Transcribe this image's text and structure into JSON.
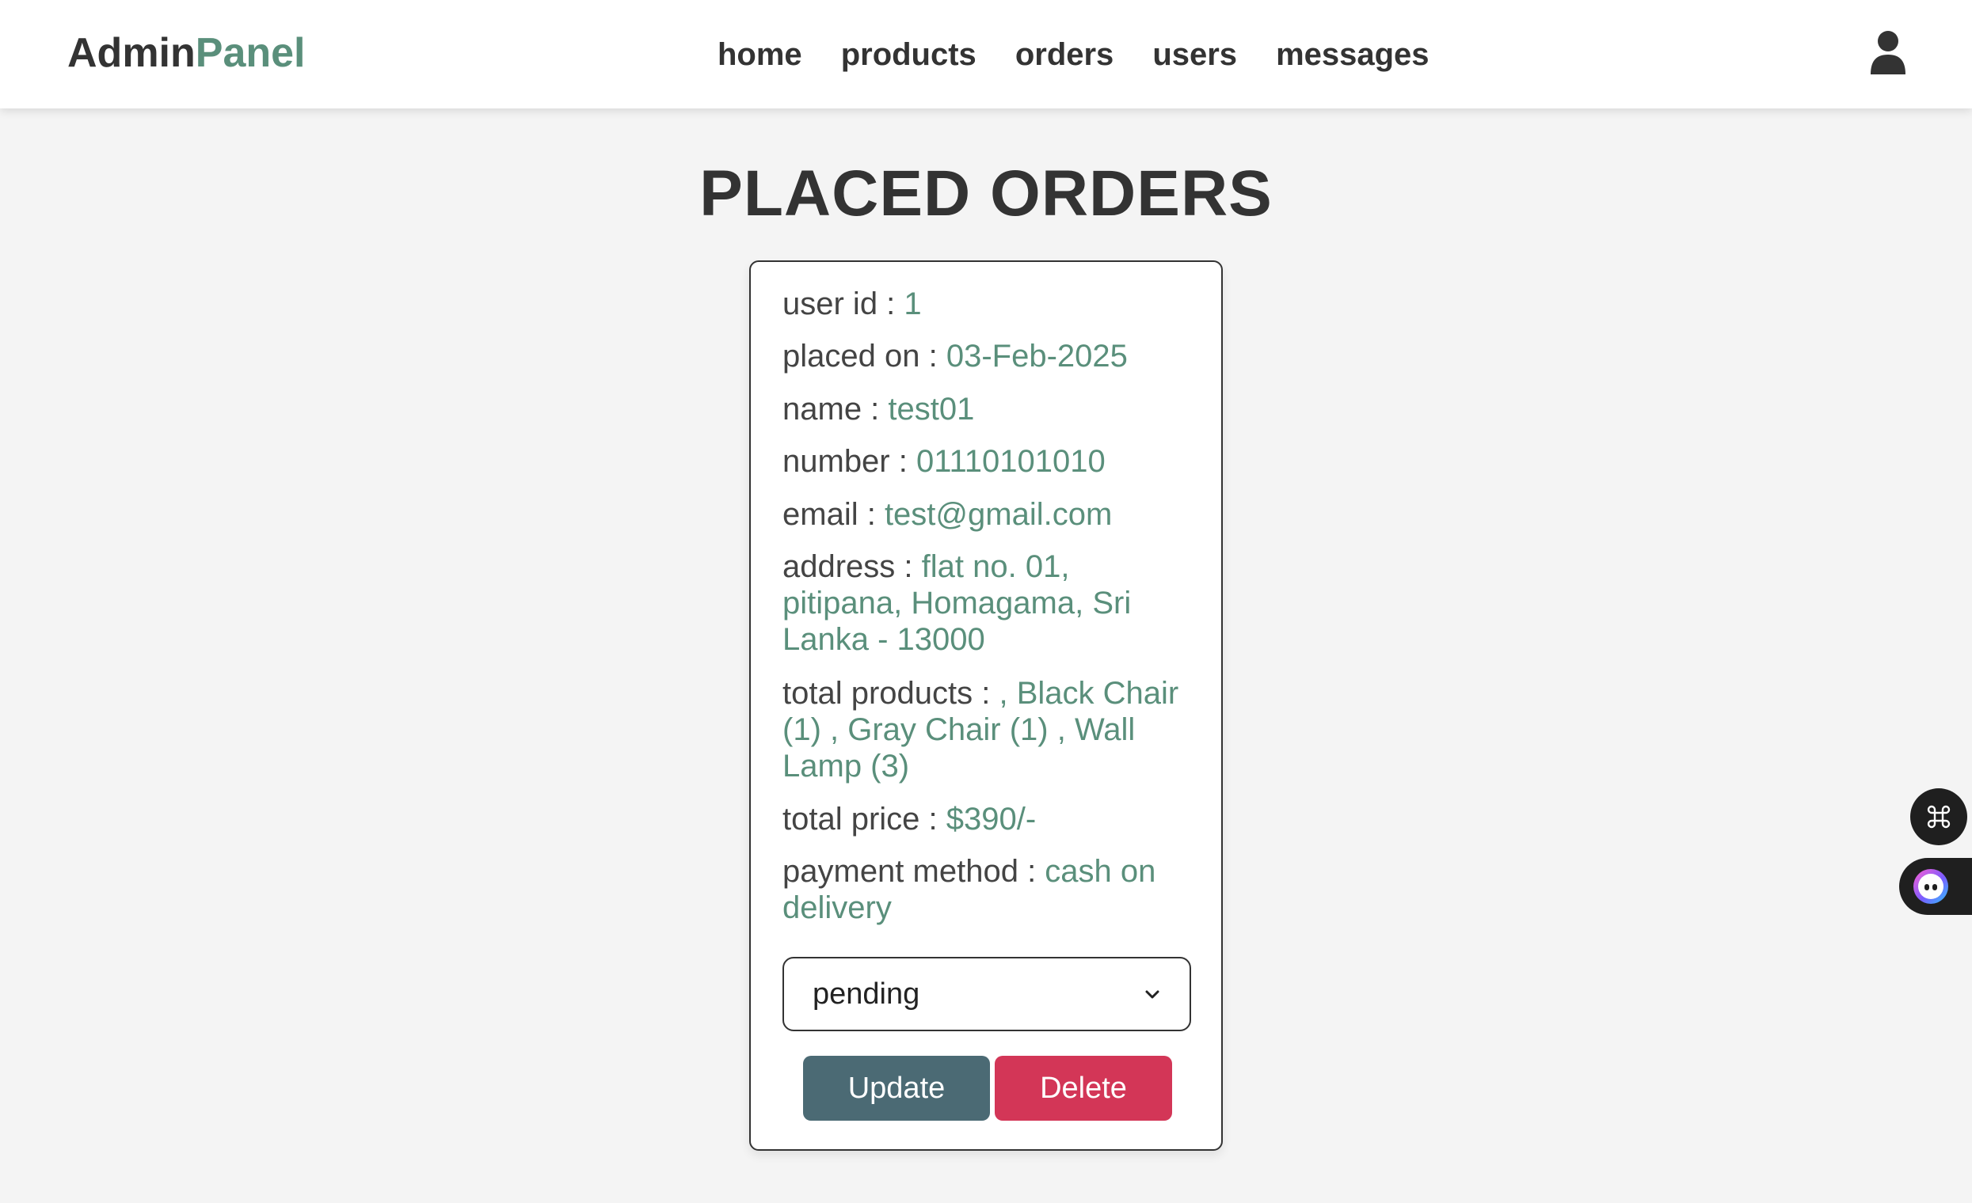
{
  "header": {
    "logo_part1": "Admin",
    "logo_part2": "Panel",
    "nav": [
      {
        "label": "home"
      },
      {
        "label": "products"
      },
      {
        "label": "orders"
      },
      {
        "label": "users"
      },
      {
        "label": "messages"
      }
    ],
    "user_icon": "user-icon"
  },
  "page": {
    "title": "PLACED ORDERS"
  },
  "order": {
    "user_id_label": "user id : ",
    "user_id": "1",
    "placed_on_label": "placed on : ",
    "placed_on": "03-Feb-2025",
    "name_label": "name : ",
    "name": "test01",
    "number_label": "number : ",
    "number": "01110101010",
    "email_label": "email : ",
    "email": "test@gmail.com",
    "address_label": "address : ",
    "address": "flat no. 01, pitipana, Homagama, Sri Lanka - 13000",
    "total_products_label": "total products : ",
    "total_products": ", Black Chair (1) , Gray Chair (1) , Wall Lamp (3)",
    "total_price_label": "total price : ",
    "total_price": "$390/-",
    "payment_method_label": "payment method : ",
    "payment_method": "cash on delivery",
    "status_selected": "pending",
    "update_label": "Update",
    "delete_label": "Delete"
  },
  "colors": {
    "accent": "#5a8f7b",
    "update_button": "#4b6a74",
    "delete_button": "#d33657",
    "background": "#f4f4f4"
  },
  "floating": {
    "command_icon": "command-icon",
    "assistant_icon": "assistant-face-icon"
  }
}
